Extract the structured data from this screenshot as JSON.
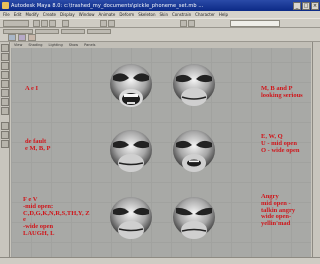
{
  "window": {
    "title": "Autodesk Maya 8.0: c:\\trashed_my_documents\\pickle_phoneme_set.mb ...",
    "min_glyph": "_",
    "max_glyph": "□",
    "close_glyph": "×"
  },
  "menubar": {
    "items": [
      "File",
      "Edit",
      "Modify",
      "Create",
      "Display",
      "Window",
      "Animate",
      "Deform",
      "Skeleton",
      "Skin",
      "Constrain",
      "Character",
      "Help"
    ]
  },
  "viewport": {
    "menu": [
      "View",
      "Shading",
      "Lighting",
      "Show",
      "Panels"
    ]
  },
  "labels": {
    "a_e_i": "A e I",
    "m_b_p": "M, B and P\nlooking serious",
    "default": "de fault\ne M, B, P",
    "e_w_q": "E, W, Q\nU - mid open\nO - wide open",
    "f_v": "F e V\n-mid open:\nC,D,G,K,N,R,S,TH,Y, Z\ne\n-wide open\nLAUGH, L",
    "angry": "Angry\nmid open -\ntalkin angry\nwide open-\nyellin'mad"
  },
  "faces": [
    {
      "name": "face-a-e-i",
      "mouth": "open-teeth"
    },
    {
      "name": "face-m-b-p",
      "mouth": "closed"
    },
    {
      "name": "face-default",
      "mouth": "closed"
    },
    {
      "name": "face-e-w-q",
      "mouth": "small-open"
    },
    {
      "name": "face-f-v",
      "mouth": "closed"
    },
    {
      "name": "face-angry",
      "mouth": "closed"
    }
  ],
  "colors": {
    "label_red": "#d0151a",
    "viewport_bg": "#a8a9a6",
    "titlebar_blue": "#0c2a86"
  }
}
